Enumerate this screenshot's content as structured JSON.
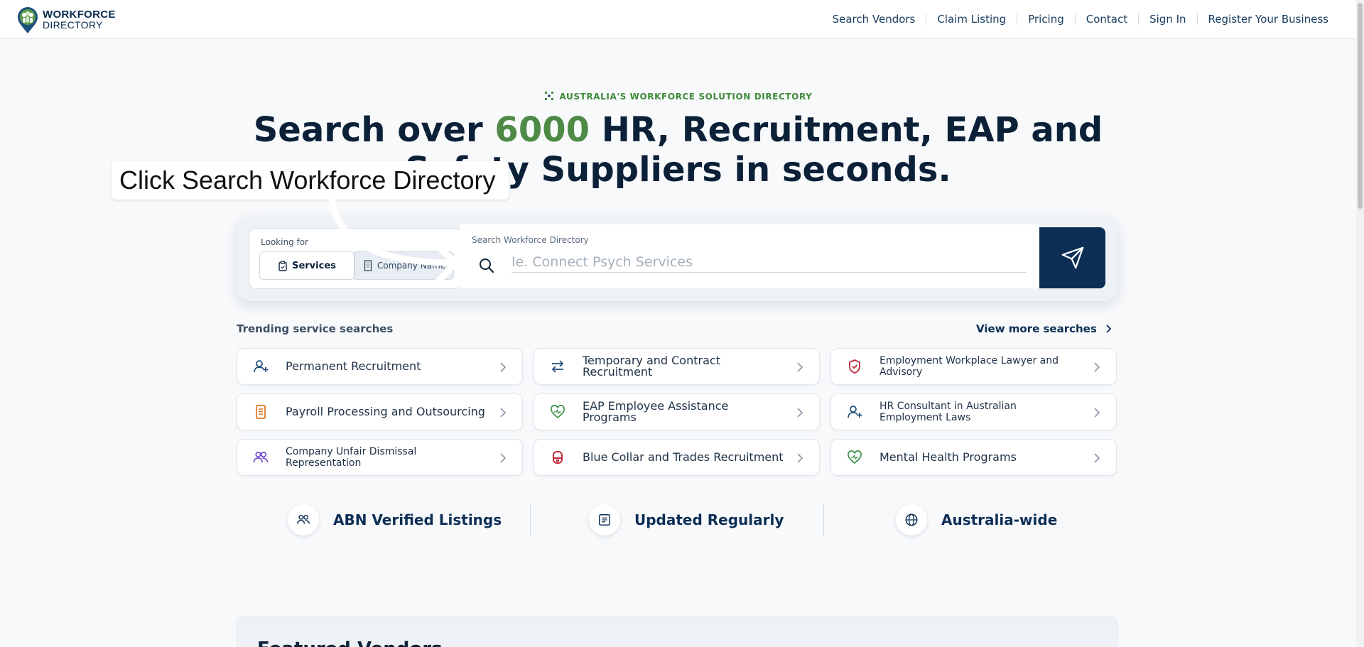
{
  "header": {
    "logo_line1": "WORKFORCE",
    "logo_line2": "DIRECTORY",
    "nav": [
      "Search Vendors",
      "Claim Listing",
      "Pricing",
      "Contact",
      "Sign In",
      "Register Your Business"
    ]
  },
  "hero": {
    "eyebrow": "AUSTRALIA'S WORKFORCE SOLUTION DIRECTORY",
    "title_pre": "Search over ",
    "title_accent": "6000",
    "title_post_line1": " HR, Recruitment, EAP and",
    "title_line2": "Safety Suppliers in seconds."
  },
  "search": {
    "looking_for_label": "Looking for",
    "mode_services": "Services",
    "mode_company": "Company Name",
    "field_label": "Search Workforce Directory",
    "placeholder": "Ie. Connect Psych Services",
    "value": ""
  },
  "callout": {
    "text": "Click Search Workforce Directory"
  },
  "trending": {
    "title": "Trending service searches",
    "view_more": "View more searches",
    "items": [
      {
        "label": "Permanent Recruitment",
        "icon": "user-plus-icon",
        "color": "#1f4d7a"
      },
      {
        "label": "Temporary and Contract Recruitment",
        "icon": "arrows-swap-icon",
        "color": "#1f4d7a"
      },
      {
        "label": "Employment Workplace Lawyer and Advisory",
        "icon": "shield-check-icon",
        "color": "#c0283a"
      },
      {
        "label": "Payroll Processing and Outsourcing",
        "icon": "document-icon",
        "color": "#d8731c"
      },
      {
        "label": "EAP Employee Assistance Programs",
        "icon": "heart-pulse-icon",
        "color": "#3a8f4a"
      },
      {
        "label": "HR Consultant in Australian Employment Laws",
        "icon": "user-plus-icon",
        "color": "#1f4d7a"
      },
      {
        "label": "Company Unfair Dismissal Representation",
        "icon": "users-icon",
        "color": "#6a3fc7"
      },
      {
        "label": "Blue Collar and Trades Recruitment",
        "icon": "hard-hat-icon",
        "color": "#c0283a"
      },
      {
        "label": "Mental Health Programs",
        "icon": "heart-pulse-icon",
        "color": "#3a8f4a"
      }
    ]
  },
  "features": [
    {
      "label": "ABN Verified Listings",
      "icon": "users-icon"
    },
    {
      "label": "Updated Regularly",
      "icon": "list-doc-icon"
    },
    {
      "label": "Australia-wide",
      "icon": "globe-icon"
    }
  ],
  "featured": {
    "title": "Featured Vendors"
  }
}
